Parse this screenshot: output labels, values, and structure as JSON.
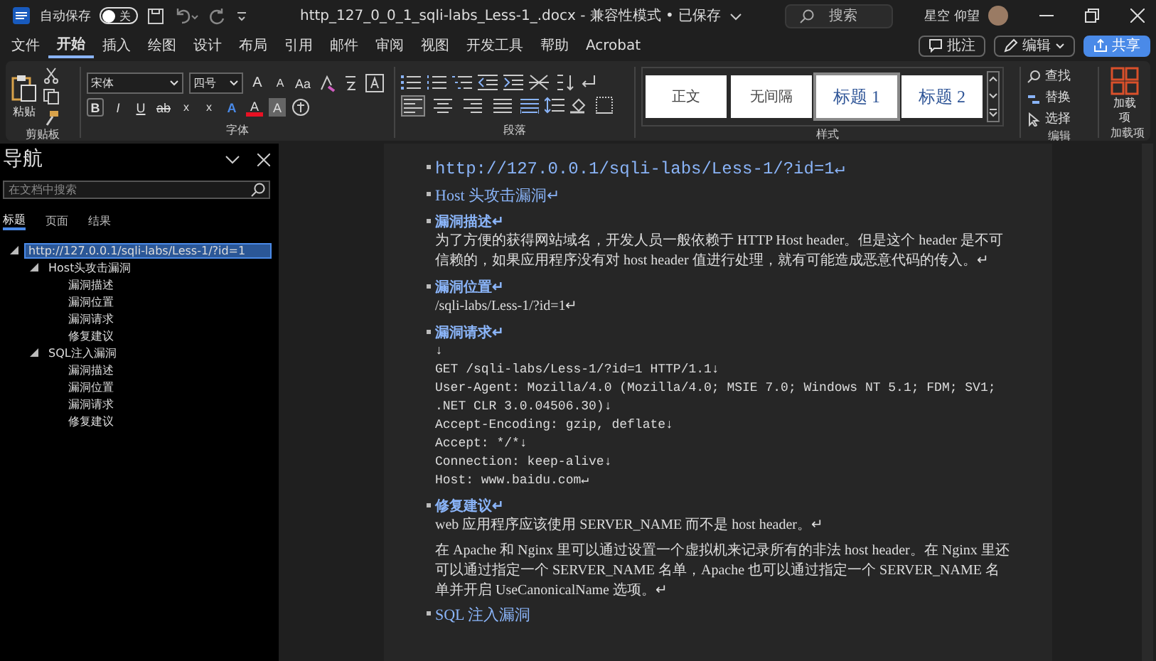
{
  "title_bar": {
    "autosave_label": "自动保存",
    "autosave_on": false,
    "autosave_state": "关",
    "document_title": "http_127_0_0_1_sqli-labs_Less-1_.docx  -  兼容性模式 • 已保存",
    "search_placeholder": "搜索",
    "user_name": "星空 仰望"
  },
  "menu_tabs": [
    {
      "label": "文件",
      "selected": false
    },
    {
      "label": "开始",
      "selected": true
    },
    {
      "label": "插入",
      "selected": false
    },
    {
      "label": "绘图",
      "selected": false
    },
    {
      "label": "设计",
      "selected": false
    },
    {
      "label": "布局",
      "selected": false
    },
    {
      "label": "引用",
      "selected": false
    },
    {
      "label": "邮件",
      "selected": false
    },
    {
      "label": "审阅",
      "selected": false
    },
    {
      "label": "视图",
      "selected": false
    },
    {
      "label": "开发工具",
      "selected": false
    },
    {
      "label": "帮助",
      "selected": false
    },
    {
      "label": "Acrobat",
      "selected": false
    }
  ],
  "actions": [
    {
      "label": "批注",
      "kind": "comment"
    },
    {
      "label": "编辑",
      "kind": "edit"
    },
    {
      "label": "共享",
      "kind": "share"
    }
  ],
  "ribbon": {
    "clipboard": {
      "paste_label": "粘贴",
      "group_label": "剪贴板"
    },
    "font": {
      "font_name": "宋体",
      "font_size": "四号",
      "group_label": "字体",
      "row1": [
        {
          "label": "A",
          "kind": "grow"
        },
        {
          "label": "A",
          "kind": "shrink"
        },
        {
          "label": "Aa",
          "kind": "case"
        }
      ],
      "row2": [
        {
          "label": "B",
          "kind": "bold"
        },
        {
          "label": "I",
          "kind": "italic"
        },
        {
          "label": "U",
          "kind": "underline"
        },
        {
          "label": "ab",
          "kind": "strike"
        },
        {
          "label": "x",
          "kind": "subscript"
        },
        {
          "label": "x",
          "kind": "superscript"
        },
        {
          "label": "A",
          "kind": "effects"
        },
        {
          "label": "A",
          "kind": "color",
          "color": "#e81123"
        },
        {
          "label": "A",
          "kind": "shading"
        }
      ]
    },
    "paragraph": {
      "group_label": "段落",
      "align_buttons": [
        {
          "kind": "left",
          "selected": true
        },
        {
          "kind": "center",
          "selected": false
        },
        {
          "kind": "right",
          "selected": false
        },
        {
          "kind": "justify",
          "selected": false
        }
      ]
    },
    "styles": {
      "group_label": "样式",
      "items": [
        {
          "label": "正文",
          "kind": "body",
          "selected": false
        },
        {
          "label": "无间隔",
          "kind": "body",
          "selected": false
        },
        {
          "label": "标题 1",
          "kind": "heading",
          "selected": true
        },
        {
          "label": "标题 2",
          "kind": "heading",
          "selected": false
        }
      ]
    },
    "editing": {
      "group_label": "编辑",
      "items": [
        {
          "label": "查找",
          "kind": "find"
        },
        {
          "label": "替换",
          "kind": "replace"
        },
        {
          "label": "选择",
          "kind": "select"
        }
      ]
    },
    "addins": {
      "button_label": "加载项",
      "group_label": "加载项"
    }
  },
  "navigation": {
    "title": "导航",
    "search_placeholder": "在文档中搜索",
    "tabs": [
      {
        "label": "标题",
        "selected": true
      },
      {
        "label": "页面",
        "selected": false
      },
      {
        "label": "结果",
        "selected": false
      }
    ],
    "tree": [
      {
        "label": "http://127.0.0.1/sqli-labs/Less-1/?id=1",
        "selected": true,
        "expanded": true,
        "children": [
          {
            "label": "Host头攻击漏洞",
            "selected": false,
            "expanded": true,
            "children": [
              {
                "label": "漏洞描述",
                "selected": false
              },
              {
                "label": "漏洞位置",
                "selected": false
              },
              {
                "label": "漏洞请求",
                "selected": false
              },
              {
                "label": "修复建议",
                "selected": false
              }
            ]
          },
          {
            "label": "SQL注入漏洞",
            "selected": false,
            "expanded": true,
            "children": [
              {
                "label": "漏洞描述",
                "selected": false
              },
              {
                "label": "漏洞位置",
                "selected": false
              },
              {
                "label": "漏洞请求",
                "selected": false
              },
              {
                "label": "修复建议",
                "selected": false
              }
            ]
          }
        ]
      }
    ]
  },
  "document": {
    "blocks": [
      {
        "kind": "title",
        "text": "http://127.0.0.1/sqli-labs/Less-1/?id=1↵"
      },
      {
        "kind": "heading1",
        "text": "Host 头攻击漏洞↵"
      },
      {
        "kind": "heading2",
        "text": "漏洞描述↵"
      },
      {
        "kind": "paragraph",
        "text": "为了方便的获得网站域名，开发人员一般依赖于 HTTP Host header。但是这个 header 是不可信赖的，如果应用程序没有对 host header 值进行处理，就有可能造成恶意代码的传入。↵"
      },
      {
        "kind": "heading2",
        "text": "漏洞位置↵"
      },
      {
        "kind": "paragraph",
        "text": "/sqli-labs/Less-1/?id=1↵"
      },
      {
        "kind": "heading2",
        "text": "漏洞请求↵"
      },
      {
        "kind": "code",
        "lines": [
          "↓",
          "GET /sqli-labs/Less-1/?id=1 HTTP/1.1↓",
          "User-Agent: Mozilla/4.0 (Mozilla/4.0; MSIE 7.0; Windows NT 5.1; FDM; SV1; .NET CLR 3.0.04506.30)↓",
          "Accept-Encoding: gzip, deflate↓",
          "Accept: */*↓",
          "Connection: keep-alive↓",
          "Host: www.baidu.com↵"
        ]
      },
      {
        "kind": "heading2",
        "text": "修复建议↵"
      },
      {
        "kind": "paragraph",
        "text": "web 应用程序应该使用 SERVER_NAME 而不是 host header。↵"
      },
      {
        "kind": "paragraph",
        "text": "在 Apache 和 Nginx 里可以通过设置一个虚拟机来记录所有的非法 host header。在 Nginx 里还可以通过指定一个 SERVER_NAME 名单，Apache 也可以通过指定一个 SERVER_NAME 名单并开启 UseCanonicalName 选项。↵"
      },
      {
        "kind": "heading1",
        "text": "SQL 注入漏洞"
      }
    ]
  }
}
